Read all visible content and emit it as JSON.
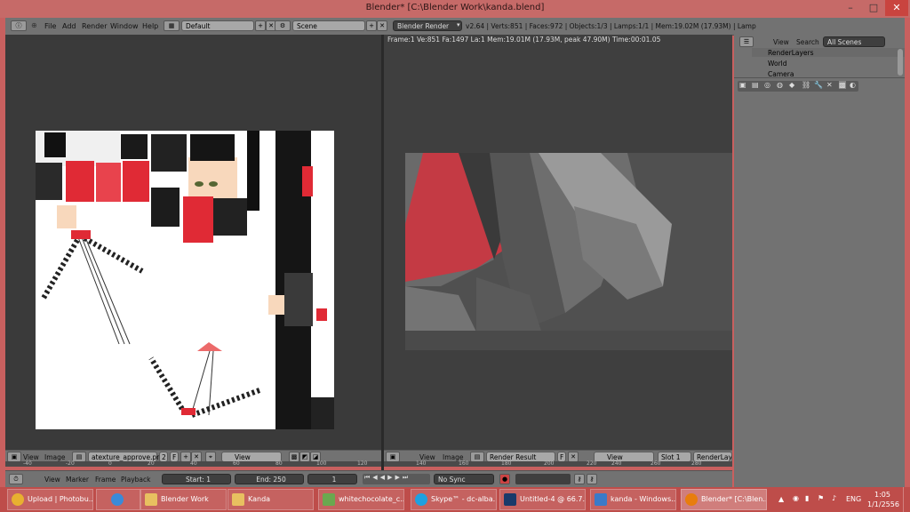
{
  "window": {
    "title": "Blender* [C:\\Blender Work\\kanda.blend]",
    "controls": [
      "–",
      "□",
      "✕"
    ]
  },
  "info_header": {
    "menus": [
      "File",
      "Add",
      "Render",
      "Window",
      "Help"
    ],
    "layout": "Default",
    "scene": "Scene",
    "engine": "Blender Render",
    "stats": "v2.64 | Verts:851 | Faces:972 | Objects:1/3 | Lamps:1/1 | Mem:19.02M (17.93M) | Lamp"
  },
  "render_info": "Frame:1 Ve:851 Fa:1497 La:1 Mem:19.01M (17.93M, peak 47.90M) Time:00:01.05",
  "outliner": {
    "menus": [
      "View",
      "Search"
    ],
    "filter": "All Scenes",
    "items": [
      "RenderLayers",
      "World",
      "Camera"
    ]
  },
  "uv_header": {
    "menus": [
      "View",
      "Image"
    ],
    "image_name": "atexture_approve.png",
    "users": "2",
    "fake": "F",
    "view_mode": "View"
  },
  "render_header": {
    "menus": [
      "View",
      "Image"
    ],
    "image_name": "Render Result",
    "fake": "F",
    "view_mode": "View",
    "slot": "Slot 1",
    "layer": "RenderLayer"
  },
  "uv_ruler": [
    "-40",
    "-20",
    "0",
    "20",
    "40",
    "60",
    "80",
    "100",
    "120"
  ],
  "render_ruler": [
    "140",
    "160",
    "180",
    "200",
    "220",
    "240",
    "260",
    "280"
  ],
  "timeline": {
    "menus": [
      "View",
      "Marker",
      "Frame",
      "Playback"
    ],
    "start": "Start: 1",
    "end": "End: 250",
    "current": "1",
    "sync": "No Sync"
  },
  "taskbar": {
    "apps": [
      {
        "label": "Upload | Photobu...",
        "icon": "chrome-icon",
        "color": "#e8b030"
      },
      {
        "label": "",
        "icon": "ie-icon",
        "color": "#3a8ad8"
      },
      {
        "label": "Blender Work",
        "icon": "folder-icon",
        "color": "#e8c060"
      },
      {
        "label": "Kanda",
        "icon": "folder-icon",
        "color": "#e8c060"
      },
      {
        "label": "whitechocolate_c...",
        "icon": "image-icon",
        "color": "#6aa84f"
      },
      {
        "label": "Skype™ - dc-alba...",
        "icon": "skype-icon",
        "color": "#1ea0e0"
      },
      {
        "label": "Untitled-4 @ 66.7...",
        "icon": "photoshop-icon",
        "color": "#1a3a6a"
      },
      {
        "label": "kanda - Windows...",
        "icon": "photo-viewer-icon",
        "color": "#3a7ac8"
      },
      {
        "label": "Blender* [C:\\Blen...",
        "icon": "blender-icon",
        "color": "#e87d0d"
      }
    ],
    "lang": "ENG",
    "time": "1:05",
    "date": "1/1/2556"
  }
}
